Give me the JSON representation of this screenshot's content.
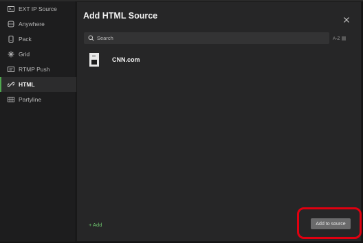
{
  "sidebar": {
    "items": [
      {
        "label": "EXT IP Source",
        "icon": "ext-ip-source-icon"
      },
      {
        "label": "Anywhere",
        "icon": "anywhere-icon"
      },
      {
        "label": "Pack",
        "icon": "pack-icon"
      },
      {
        "label": "Grid",
        "icon": "grid-icon"
      },
      {
        "label": "RTMP Push",
        "icon": "rtmp-push-icon"
      },
      {
        "label": "HTML",
        "icon": "link-icon",
        "active": true
      },
      {
        "label": "Partyline",
        "icon": "partyline-icon"
      }
    ]
  },
  "dialog": {
    "title": "Add HTML Source",
    "search_placeholder": "Search",
    "sort_label": "A-Z",
    "sources": [
      {
        "name": "CNN.com"
      }
    ],
    "add_label": "+ Add",
    "add_to_source_label": "Add to source"
  },
  "colors": {
    "accent": "#4fa84f",
    "highlight": "#e00010"
  }
}
